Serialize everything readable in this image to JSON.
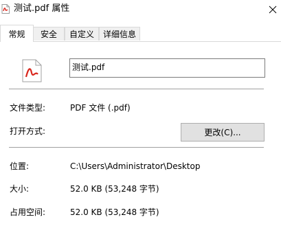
{
  "window": {
    "title": "测试.pdf 属性",
    "icon": "pdf-file-icon",
    "close_icon": "close-icon"
  },
  "tabs": [
    {
      "label": "常规",
      "active": true
    },
    {
      "label": "安全",
      "active": false
    },
    {
      "label": "自定义",
      "active": false
    },
    {
      "label": "详细信息",
      "active": false
    }
  ],
  "general": {
    "file_name": "测试.pdf",
    "file_type_label": "文件类型:",
    "file_type_value": "PDF 文件 (.pdf)",
    "open_with_label": "打开方式:",
    "change_button": "更改(C)...",
    "location_label": "位置:",
    "location_value": "C:\\Users\\Administrator\\Desktop",
    "size_label": "大小:",
    "size_value": "52.0 KB (53,248 字节)",
    "disk_size_label": "占用空间:",
    "disk_size_value": "52.0 KB (53,248 字节)"
  },
  "colors": {
    "pdf_icon_red": "#d9261c",
    "accent_border": "#d9d9d9"
  }
}
